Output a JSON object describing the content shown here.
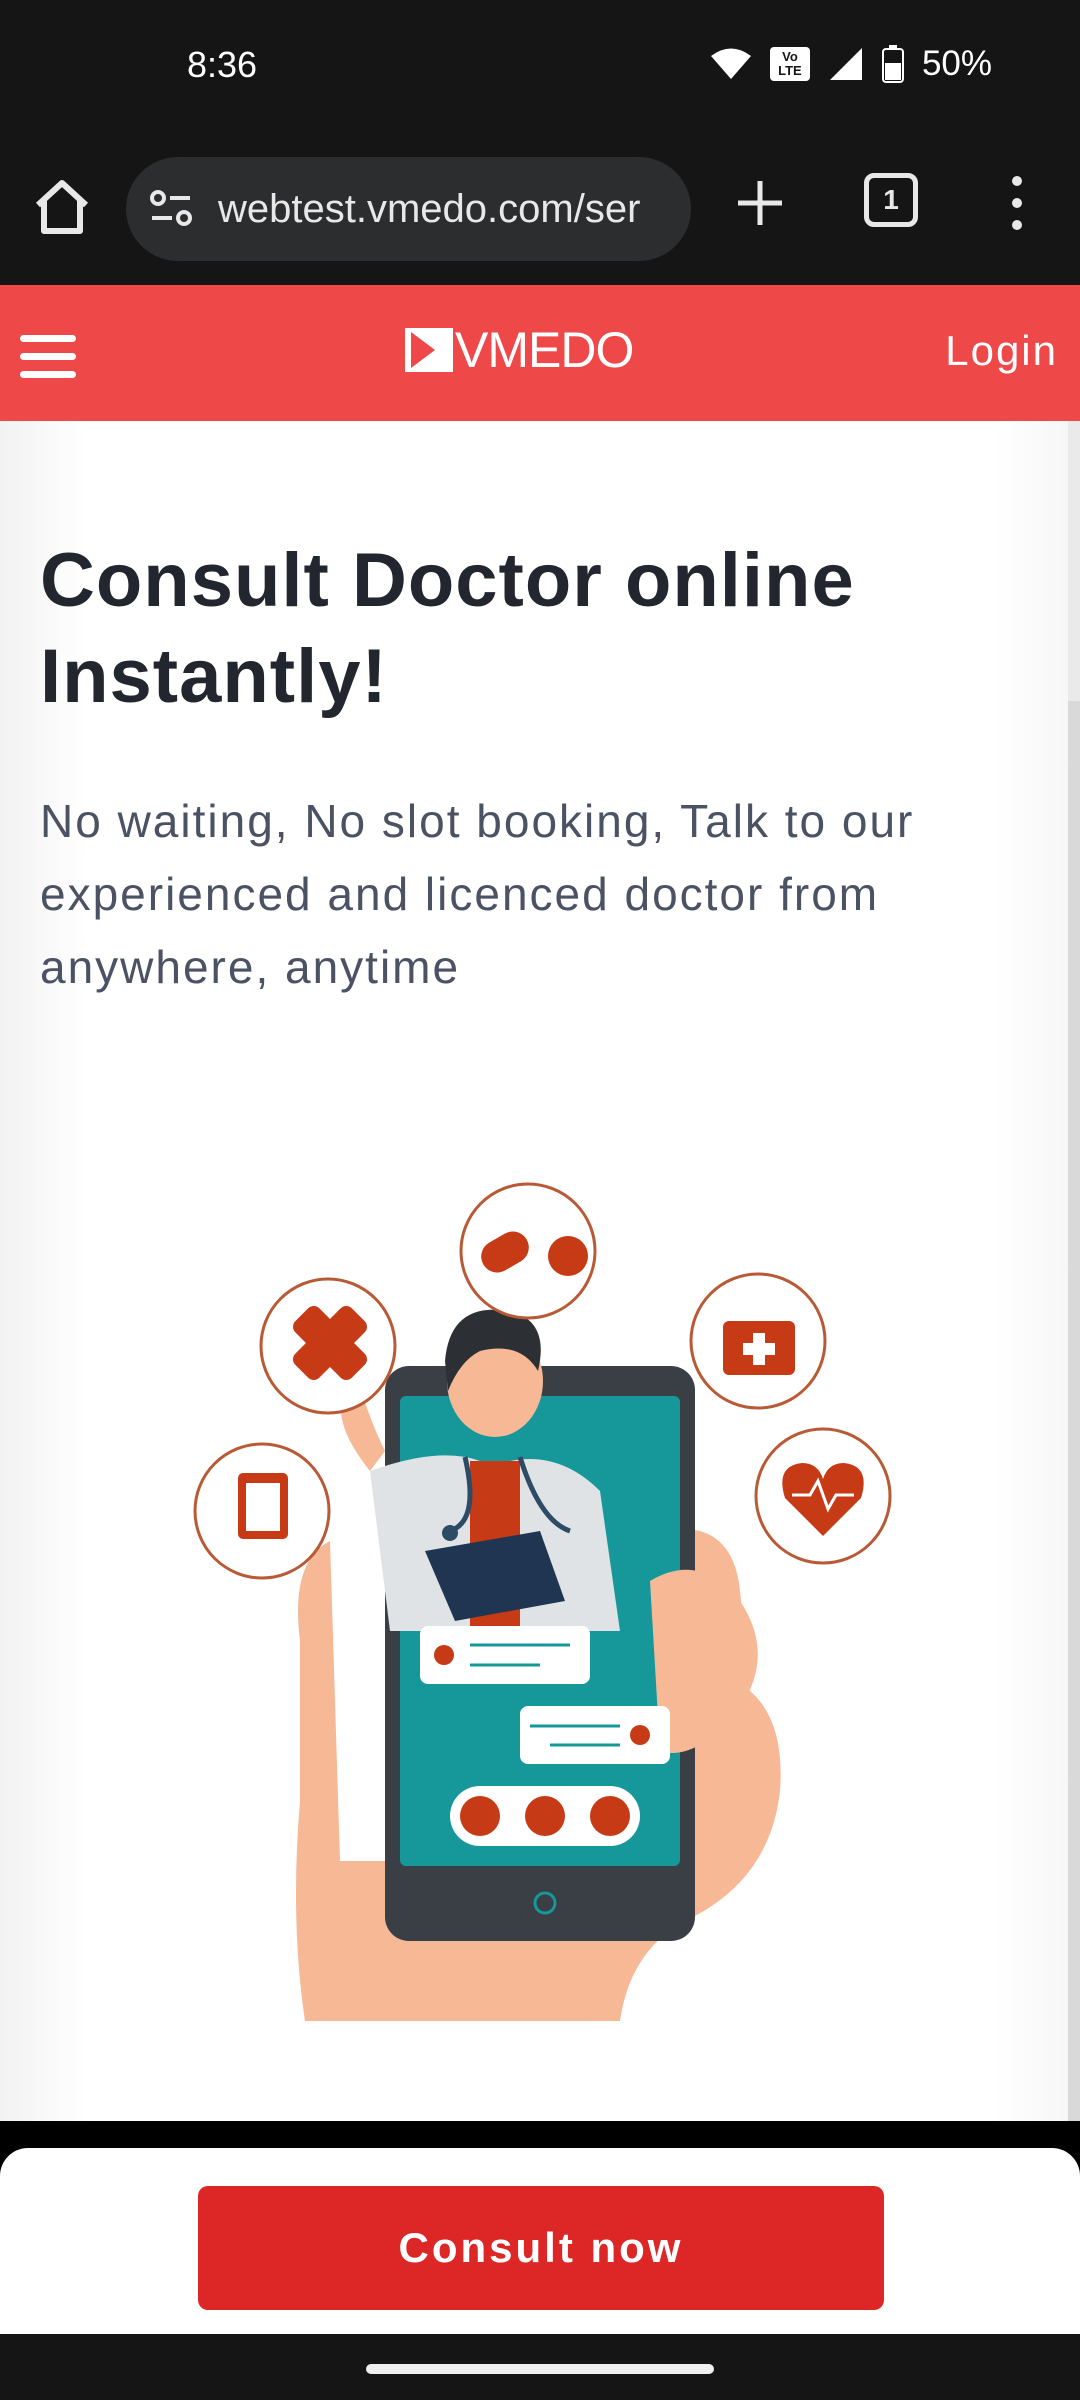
{
  "status_bar": {
    "time": "8:36",
    "battery": "50%",
    "volte_label": "Vo LTE",
    "icons": [
      "wifi-icon",
      "volte-icon",
      "signal-icon",
      "battery-icon"
    ]
  },
  "browser": {
    "url": "webtest.vmedo.com/ser",
    "tab_count": "1",
    "icons": [
      "home-icon",
      "site-info-icon",
      "new-tab-icon",
      "tabs-icon",
      "more-menu-icon"
    ]
  },
  "header": {
    "logo_text": "VMEDO",
    "login_label": "Login",
    "brand_color": "#ef4848"
  },
  "hero": {
    "title": "Consult Doctor online Instantly!",
    "subtitle": "No waiting, No slot booking, Talk to our experienced and licenced doctor from anywhere, anytime"
  },
  "cta": {
    "label": "Consult now",
    "color": "#dd2626"
  }
}
